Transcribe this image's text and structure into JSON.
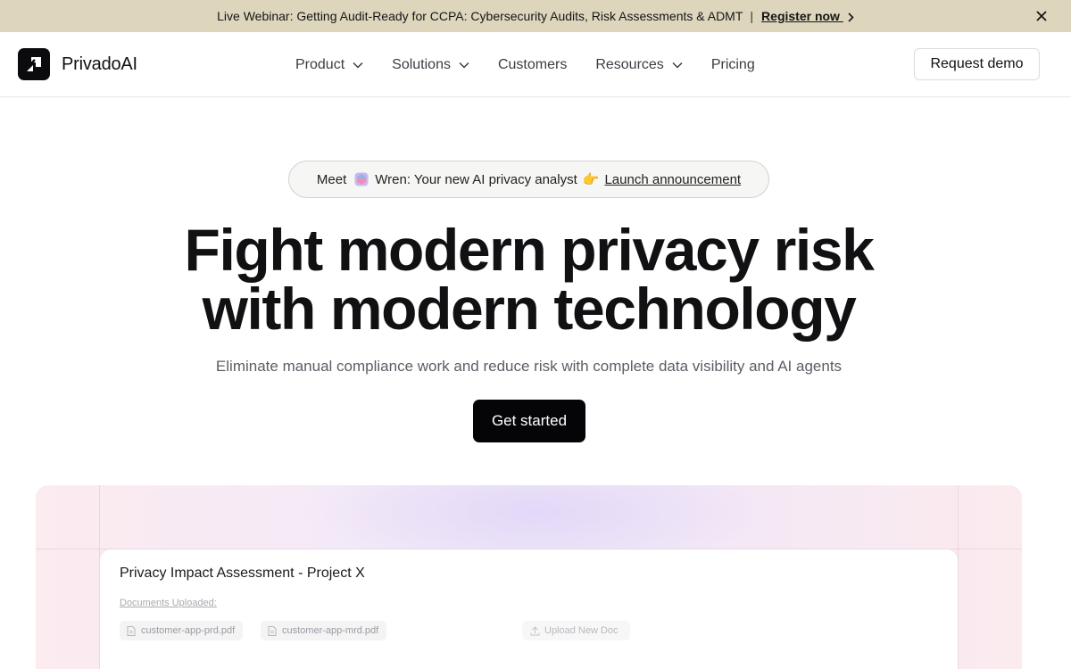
{
  "announcement": {
    "text": "Live Webinar: Getting Audit-Ready for CCPA: Cybersecurity Audits, Risk Assessments & ADMT",
    "separator": "|",
    "link_label": "Register now"
  },
  "brand": {
    "name": "PrivadoAI"
  },
  "nav": {
    "items": [
      {
        "label": "Product",
        "has_caret": true
      },
      {
        "label": "Solutions",
        "has_caret": true
      },
      {
        "label": "Customers",
        "has_caret": false
      },
      {
        "label": "Resources",
        "has_caret": true
      },
      {
        "label": "Pricing",
        "has_caret": false
      }
    ],
    "demo_label": "Request demo"
  },
  "hero": {
    "pill": {
      "prefix": "Meet",
      "icon": "wren-icon",
      "text": "Wren: Your new AI privacy analyst",
      "emoji": "👉",
      "link_label": "Launch announcement"
    },
    "headline_line1": "Fight modern privacy risk",
    "headline_line2": "with modern technology",
    "subhead": "Eliminate manual compliance work and reduce risk with complete data visibility and AI agents",
    "cta_label": "Get started"
  },
  "showcase": {
    "card_title": "Privacy Impact Assessment - Project X",
    "documents_label": "Documents Uploaded:",
    "documents": [
      "customer-app-prd.pdf",
      "customer-app-mrd.pdf"
    ],
    "upload_label": "Upload New Doc"
  },
  "colors": {
    "announcement_bg": "#ddd6bd",
    "cta_bg": "#050507",
    "text_primary": "#111114",
    "text_muted": "#5b5e66"
  }
}
